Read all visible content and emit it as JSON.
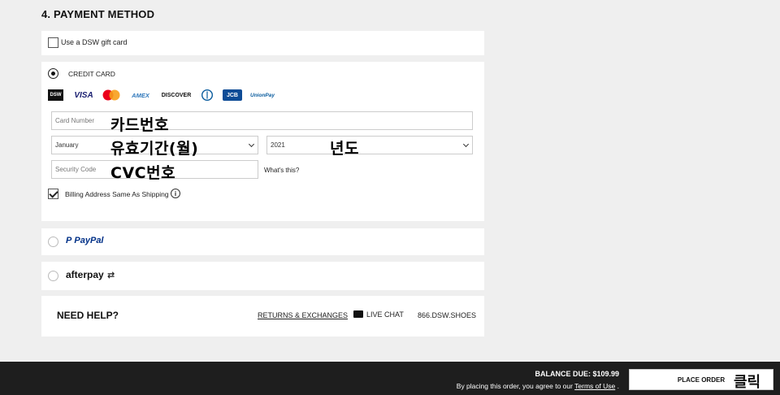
{
  "section_title": "4. PAYMENT METHOD",
  "gift_card": {
    "label": "Use a DSW gift card",
    "checked": false
  },
  "credit_card": {
    "label": "CREDIT CARD",
    "selected": true,
    "logos": [
      "DSW",
      "VISA",
      "mastercard",
      "AMEX",
      "DISCOVER",
      "Diners",
      "JCB",
      "UnionPay"
    ],
    "card_number_placeholder": "Card Number",
    "card_number_annotation": "카드번호",
    "month_value": "January",
    "month_annotation": "유효기간(월)",
    "year_value": "2021",
    "year_annotation": "년도",
    "security_placeholder": "Security Code",
    "security_annotation": "CVC번호",
    "whats_this": "What's this?",
    "billing_label": "Billing Address Same As Shipping",
    "billing_checked": true
  },
  "paypal": {
    "label": "PayPal",
    "selected": false
  },
  "afterpay": {
    "label": "afterpay",
    "selected": false
  },
  "help": {
    "title": "NEED HELP?",
    "returns": "RETURNS & EXCHANGES",
    "live_chat": "LIVE CHAT",
    "phone": "866.DSW.SHOES"
  },
  "footer": {
    "balance_due": "BALANCE DUE: $109.99",
    "agree_prefix": "By placing this order, you agree to our",
    "terms": "Terms of Use",
    "agree_suffix": ".",
    "place_order": "PLACE ORDER",
    "place_order_annotation": "클릭"
  },
  "colors": {
    "visa": "#1a1f71",
    "mc_red": "#eb001b",
    "mc_yellow": "#f79e1b",
    "paypal_dark": "#003087",
    "paypal_light": "#009cde",
    "amex": "#2e77bb"
  }
}
